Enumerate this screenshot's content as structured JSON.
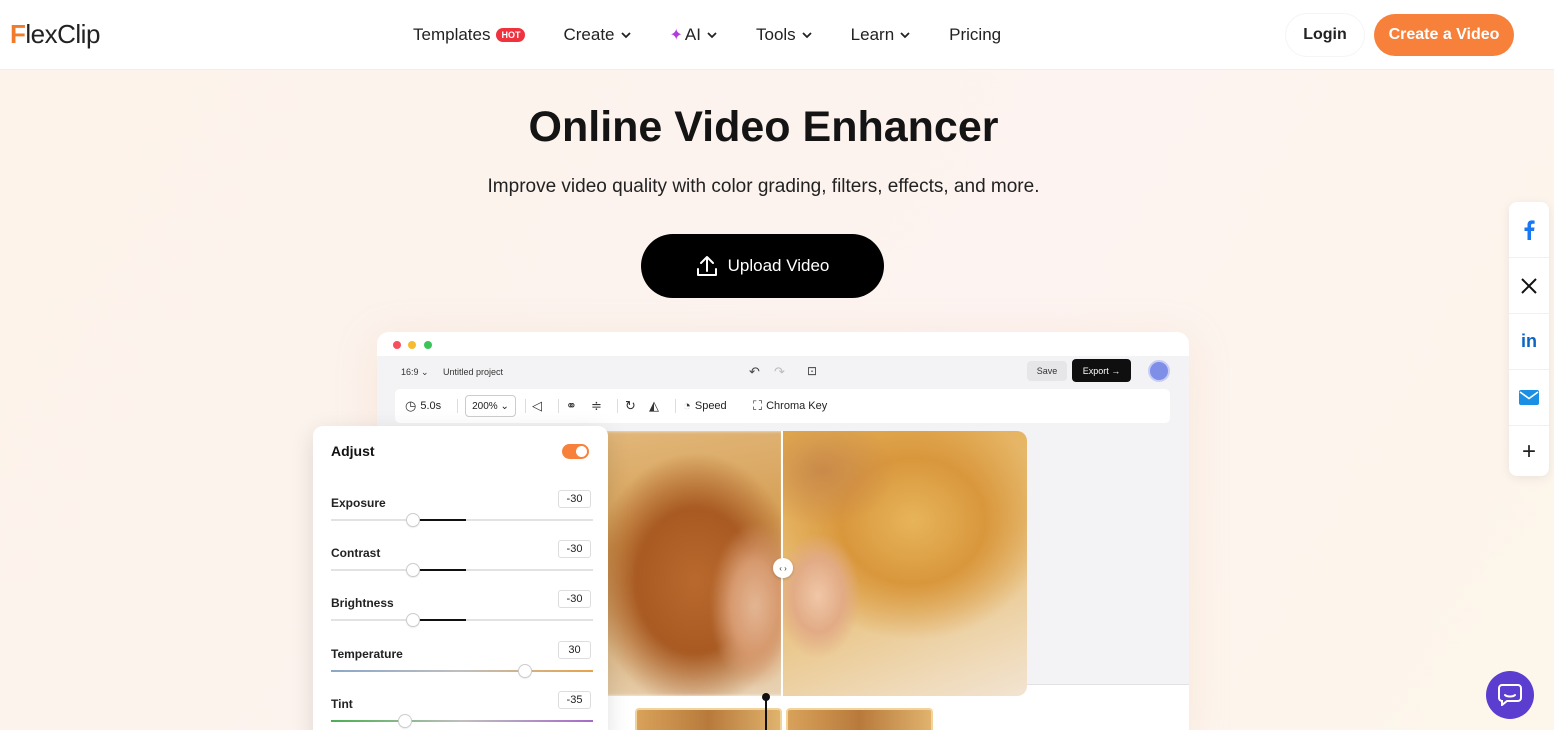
{
  "nav": {
    "logo": "FlexClip",
    "items": [
      {
        "label": "Templates",
        "badge": "HOT",
        "dropdown": false
      },
      {
        "label": "Create",
        "dropdown": true
      },
      {
        "label": "AI",
        "dropdown": true
      },
      {
        "label": "Tools",
        "dropdown": true
      },
      {
        "label": "Learn",
        "dropdown": true
      },
      {
        "label": "Pricing",
        "dropdown": false
      }
    ],
    "login": "Login",
    "cta": "Create a Video"
  },
  "hero": {
    "title": "Online Video Enhancer",
    "subtitle": "Improve video quality with color grading, filters, effects, and more.",
    "upload_label": "Upload Video"
  },
  "editor": {
    "ratio": "16:9",
    "project": "Untitled project",
    "save": "Save",
    "export": "Export →",
    "duration": "5.0s",
    "zoom": "200%",
    "speed": "Speed",
    "chroma": "Chroma Key"
  },
  "adjust": {
    "title": "Adjust",
    "enabled": true,
    "sliders": [
      {
        "label": "Exposure",
        "value": "-30"
      },
      {
        "label": "Contrast",
        "value": "-30"
      },
      {
        "label": "Brightness",
        "value": "-30"
      },
      {
        "label": "Temperature",
        "value": "30"
      },
      {
        "label": "Tint",
        "value": "-35"
      }
    ]
  },
  "social": [
    "facebook-icon",
    "x-icon",
    "linkedin-icon",
    "email-icon",
    "plus-icon"
  ],
  "colors": {
    "accent": "#f7813b",
    "hot": "#f0323f",
    "chat": "#5b3ed0"
  }
}
